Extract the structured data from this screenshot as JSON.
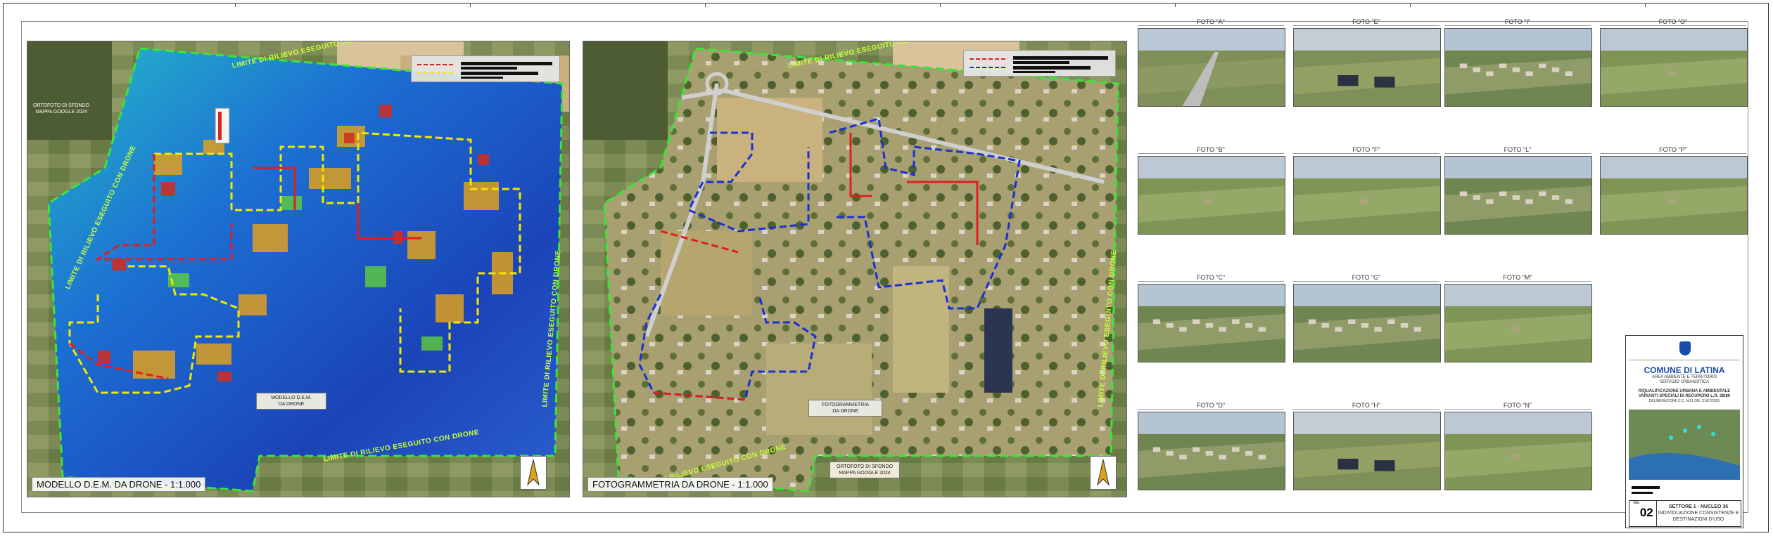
{
  "maps": {
    "left": {
      "caption": "MODELLO D.E.M. DA DRONE - 1:1.000",
      "inset_label": "MODELLO D.E.M.\nDA DRONE",
      "background_note": "ORTOFOTO DI SFONDO\nMAPPA GOOGLE 2024",
      "survey_limit_label": "LIMITE DI RILIEVO ESEGUITO CON DRONE"
    },
    "right": {
      "caption": "FOTOGRAMMETRIA DA DRONE - 1:1.000",
      "inset_label": "FOTOGRAMMETRIA\nDA DRONE",
      "background_note": "ORTOFOTO DI SFONDO\nMAPPA GOOGLE 2024",
      "survey_limit_label": "LIMITE DI RILIEVO ESEGUITO CON DRONE"
    }
  },
  "photos": [
    {
      "label": "FOTO \"A\"",
      "theme": "road"
    },
    {
      "label": "FOTO \"E\"",
      "theme": "solar"
    },
    {
      "label": "FOTO \"I\"",
      "theme": "village"
    },
    {
      "label": "FOTO \"O\"",
      "theme": "field"
    },
    {
      "label": "FOTO \"B\"",
      "theme": "field"
    },
    {
      "label": "FOTO \"F\"",
      "theme": "field"
    },
    {
      "label": "FOTO \"L\"",
      "theme": "village"
    },
    {
      "label": "FOTO \"P\"",
      "theme": "field"
    },
    {
      "label": "FOTO \"C\"",
      "theme": "village"
    },
    {
      "label": "FOTO \"G\"",
      "theme": "village"
    },
    {
      "label": "FOTO \"M\"",
      "theme": "field"
    },
    {
      "label": "FOTO \"D\"",
      "theme": "village"
    },
    {
      "label": "FOTO \"H\"",
      "theme": "solar"
    },
    {
      "label": "FOTO \"N\"",
      "theme": "field"
    }
  ],
  "title_block": {
    "municipality": "COMUNE DI LATINA",
    "department_1": "AREA AMBIENTE E TERRITORIO",
    "department_2": "SERVIZIO URBANISTICA",
    "project_1": "RIQUALIFICAZIONE URBANA E AMBIENTALE",
    "project_2": "VARIANTI SPECIALI DI RECUPERO L.R. 28/80",
    "resolution": "DELIBERAZIONE C.C. N.61 DEL 31/07/2021",
    "sheet_prefix": "Tav.",
    "sheet_number": "02",
    "sheet_title_1": "SETTORE 1 - NUCLEO 36",
    "sheet_title_2": "INDIVIDUAZIONE CONSISTENZE E",
    "sheet_title_3": "DESTINAZIONI D'USO"
  },
  "colors": {
    "survey_limit": "#39e639",
    "boundary_red": "#e01e1e",
    "boundary_yellow": "#f2e800",
    "boundary_blue": "#1a2fd6",
    "municipality_blue": "#1a4da8"
  }
}
